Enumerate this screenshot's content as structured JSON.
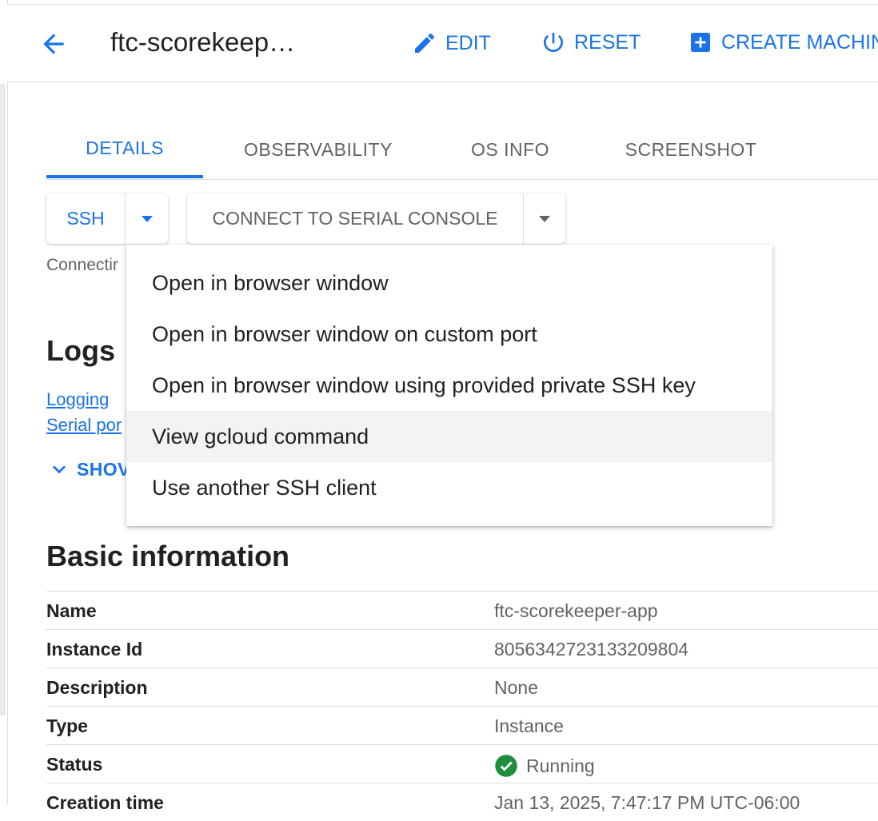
{
  "header": {
    "title": "ftc-scorekeep…",
    "edit_label": "EDIT",
    "reset_label": "RESET",
    "create_label": "CREATE MACHIN"
  },
  "tabs": [
    {
      "label": "DETAILS",
      "active": true
    },
    {
      "label": "OBSERVABILITY",
      "active": false
    },
    {
      "label": "OS INFO",
      "active": false
    },
    {
      "label": "SCREENSHOT",
      "active": false
    }
  ],
  "connect": {
    "ssh_label": "SSH",
    "serial_label": "CONNECT TO SERIAL CONSOLE",
    "status_text": "Connectir"
  },
  "logs": {
    "title": "Logs",
    "links": [
      "Logging",
      "Serial por"
    ],
    "show_label": "SHOV"
  },
  "ssh_menu": {
    "items": [
      "Open in browser window",
      "Open in browser window on custom port",
      "Open in browser window using provided private SSH key",
      "View gcloud command",
      "Use another SSH client"
    ],
    "hovered_index": 3
  },
  "basic_info": {
    "title": "Basic information",
    "rows": [
      {
        "key": "Name",
        "value": "ftc-scorekeeper-app"
      },
      {
        "key": "Instance Id",
        "value": "8056342723133209804"
      },
      {
        "key": "Description",
        "value": "None"
      },
      {
        "key": "Type",
        "value": "Instance"
      },
      {
        "key": "Status",
        "value": "Running"
      },
      {
        "key": "Creation time",
        "value": "Jan 13, 2025, 7:47:17 PM UTC-06:00"
      }
    ]
  },
  "colors": {
    "accent": "#1a73e8",
    "status_ok": "#1e8e3e",
    "text": "#202124",
    "muted": "#5f6368"
  },
  "icons": {
    "back": "arrow-back-icon",
    "edit": "pencil-icon",
    "reset": "power-icon",
    "create": "add-box-icon",
    "dropdown": "triangle-down-icon",
    "show": "chevron-down-icon",
    "status": "check-circle-icon"
  }
}
